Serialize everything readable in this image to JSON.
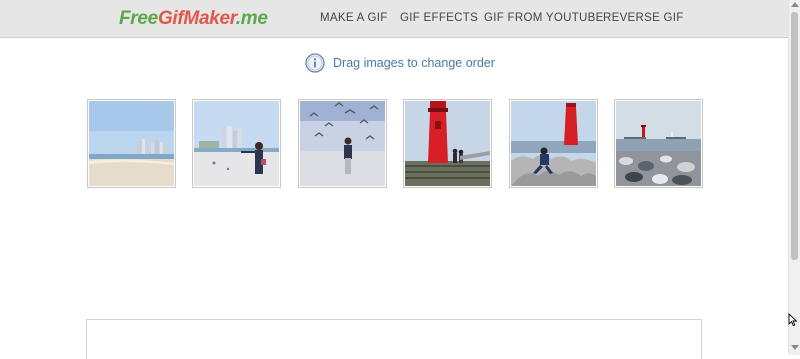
{
  "header": {
    "logo": {
      "part1": "Free",
      "part2": "GifMaker",
      "part3": ".me"
    },
    "nav": [
      "MAKE A GIF",
      "GIF EFFECTS",
      "GIF FROM YOUTUBE",
      "REVERSE GIF"
    ]
  },
  "main": {
    "hint_icon": "info-icon",
    "hint_text": "Drag images to change order",
    "thumbnails": [
      {
        "scene": "beach-city-skyline"
      },
      {
        "scene": "woman-feeding-birds-beach"
      },
      {
        "scene": "woman-among-seagulls"
      },
      {
        "scene": "red-lighthouse-couple"
      },
      {
        "scene": "woman-on-tetrapods-red-lighthouse"
      },
      {
        "scene": "rocky-shore-lighthouses"
      }
    ]
  },
  "colors": {
    "logo_green": "#5aa846",
    "logo_red": "#e0584a",
    "hint_text": "#4a78a8",
    "topbar": "#e6e6e6"
  }
}
